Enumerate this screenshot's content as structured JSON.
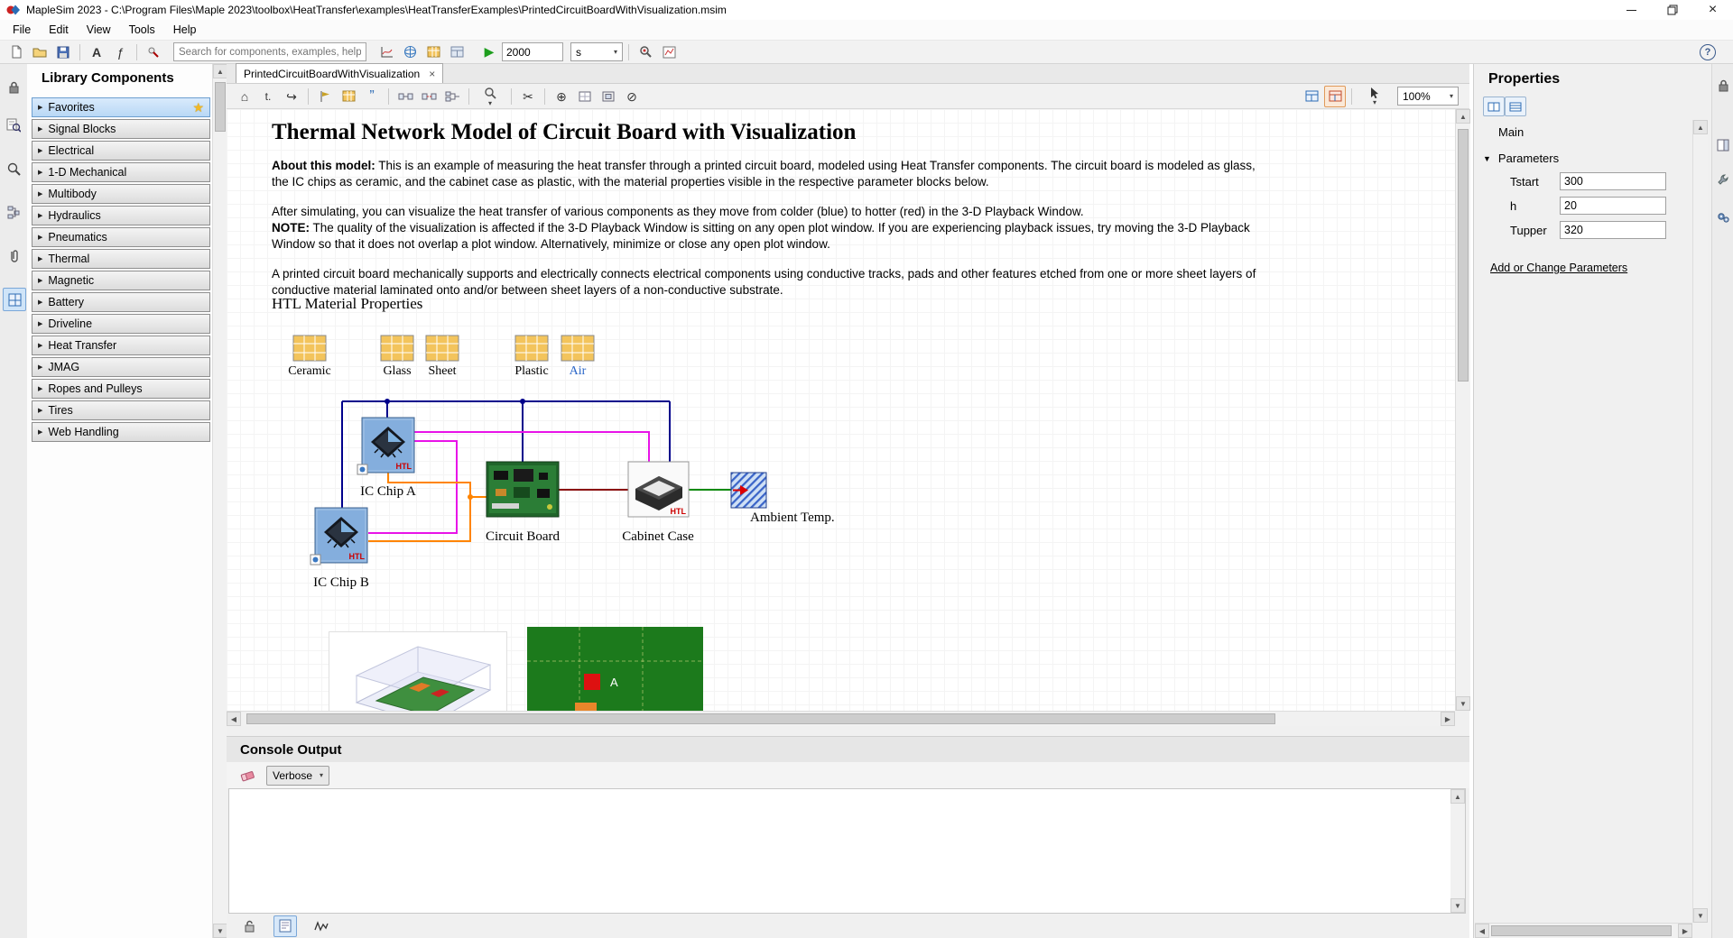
{
  "window": {
    "title": "MapleSim 2023 -  C:\\Program Files\\Maple 2023\\toolbox\\HeatTransfer\\examples\\HeatTransferExamples\\PrintedCircuitBoardWithVisualization.msim"
  },
  "menubar": {
    "items": [
      "File",
      "Edit",
      "View",
      "Tools",
      "Help"
    ]
  },
  "toolbar": {
    "search_placeholder": "Search for components, examples, help...",
    "duration_value": "2000",
    "time_unit": "s"
  },
  "library": {
    "title": "Library Components",
    "items": [
      "Favorites",
      "Signal Blocks",
      "Electrical",
      "1-D Mechanical",
      "Multibody",
      "Hydraulics",
      "Pneumatics",
      "Thermal",
      "Magnetic",
      "Battery",
      "Driveline",
      "Heat Transfer",
      "JMAG",
      "Ropes and Pulleys",
      "Tires",
      "Web Handling"
    ]
  },
  "workspace": {
    "tab_title": "PrintedCircuitBoardWithVisualization",
    "zoom": "100%",
    "document": {
      "title": "Thermal Network Model of Circuit Board with Visualization",
      "p1_lead": "About this model:",
      "p1_rest": " This is an example of measuring the heat transfer through a printed circuit board, modeled using Heat Transfer components. The circuit board is modeled as glass, the IC chips as ceramic, and the cabinet case as plastic, with the material properties visible in the respective parameter blocks below.",
      "p2": "After simulating, you can visualize the heat transfer of various components as they move from colder (blue) to hotter (red) in the 3-D Playback Window.",
      "p3_lead": "NOTE:",
      "p3_rest": " The quality of the visualization is affected if the 3-D Playback Window is sitting on any open plot window. If you are experiencing playback issues, try moving the 3-D Playback Window so that it does not overlap a plot window.  Alternatively, minimize or close any open plot window.",
      "p4": "A printed circuit board mechanically supports and electrically connects electrical components using conductive tracks, pads and other features etched from one or more sheet layers of conductive material laminated onto and/or between sheet layers of a non-conductive substrate.",
      "section_heading": "HTL Material Properties"
    },
    "materials": [
      "Ceramic",
      "Glass",
      "Sheet",
      "Plastic",
      "Air"
    ],
    "diagram": {
      "components": [
        {
          "label": "IC Chip A"
        },
        {
          "label": "IC Chip B"
        },
        {
          "label": "Circuit Board"
        },
        {
          "label": "Cabinet Case"
        },
        {
          "label": "Ambient Temp."
        }
      ],
      "badge": "HTL",
      "viz_label": "A"
    }
  },
  "console": {
    "title": "Console Output",
    "verbosity": "Verbose"
  },
  "properties": {
    "title": "Properties",
    "tab": "Main",
    "group": "Parameters",
    "params": [
      {
        "label": "Tstart",
        "value": "300"
      },
      {
        "label": "h",
        "value": "20"
      },
      {
        "label": "Tupper",
        "value": "320"
      }
    ],
    "link": "Add or Change Parameters"
  },
  "icons": {
    "close": "×",
    "star": "★",
    "play": "▶",
    "expand_arrow": "▶",
    "chevron_down": "▾",
    "scroll_up": "▲",
    "scroll_down": "▼",
    "scroll_left": "◀",
    "scroll_right": "▶",
    "help": "?",
    "home": "⌂",
    "redo": "↪",
    "scissors": "✂",
    "zoom_in": "⊕",
    "disable": "⊘",
    "quote": "”",
    "text_tool": "A",
    "units_tool": "ƒ",
    "text_small": "t."
  },
  "colors": {
    "wire_navy": "#00008b",
    "wire_magenta": "#e813e8",
    "wire_orange": "#ff8400",
    "wire_darkred": "#8b1010",
    "wire_green": "#0d8a0d",
    "arrow_red": "#dd0000",
    "htl_red": "#cc0000",
    "material_yellow": "#f3c45c",
    "pcb_green": "#2b7d36",
    "chip_blue": "#84aedd",
    "play_green": "#1e9e1e"
  }
}
